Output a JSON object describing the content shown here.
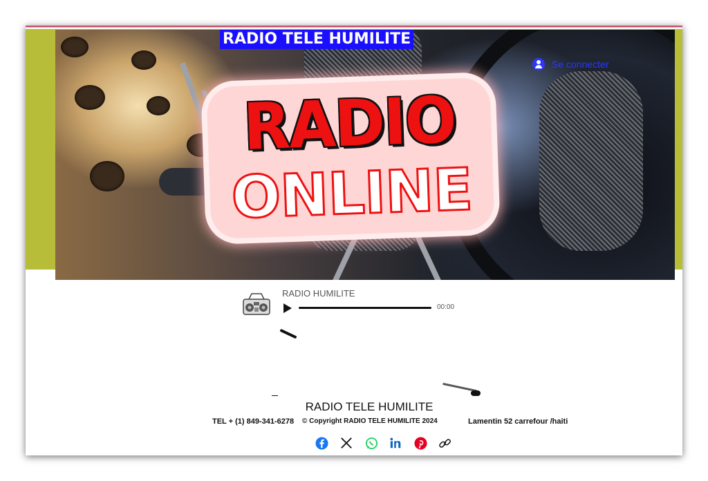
{
  "header": {
    "site_title": "RADIO TELE HUMILITE",
    "login_label": "Se connecter",
    "login_icon": "user-circle-icon"
  },
  "hero": {
    "logo_line1": "RADIO",
    "logo_line2": "ONLINE"
  },
  "player": {
    "track_title": "RADIO HUMILITE",
    "time": "00:00",
    "icon": "boombox-icon"
  },
  "footer": {
    "title": "RADIO TELE HUMILITE",
    "phone": "TEL + (1) 849-341-6278",
    "copyright": "© Copyright RADIO TELE HUMILITE 2024",
    "address": "Lamentin 52 carrefour /haiti",
    "social": [
      {
        "name": "facebook-icon",
        "color": "#1877f2"
      },
      {
        "name": "x-twitter-icon",
        "color": "#111111"
      },
      {
        "name": "whatsapp-icon",
        "color": "#25d366"
      },
      {
        "name": "linkedin-icon",
        "color": "#0a66c2"
      },
      {
        "name": "pinterest-icon",
        "color": "#e60023"
      },
      {
        "name": "link-icon",
        "color": "#111111"
      }
    ]
  },
  "colors": {
    "title_bg": "#1a10ff",
    "band": "#b7bd38",
    "accent": "#2b37ff"
  }
}
